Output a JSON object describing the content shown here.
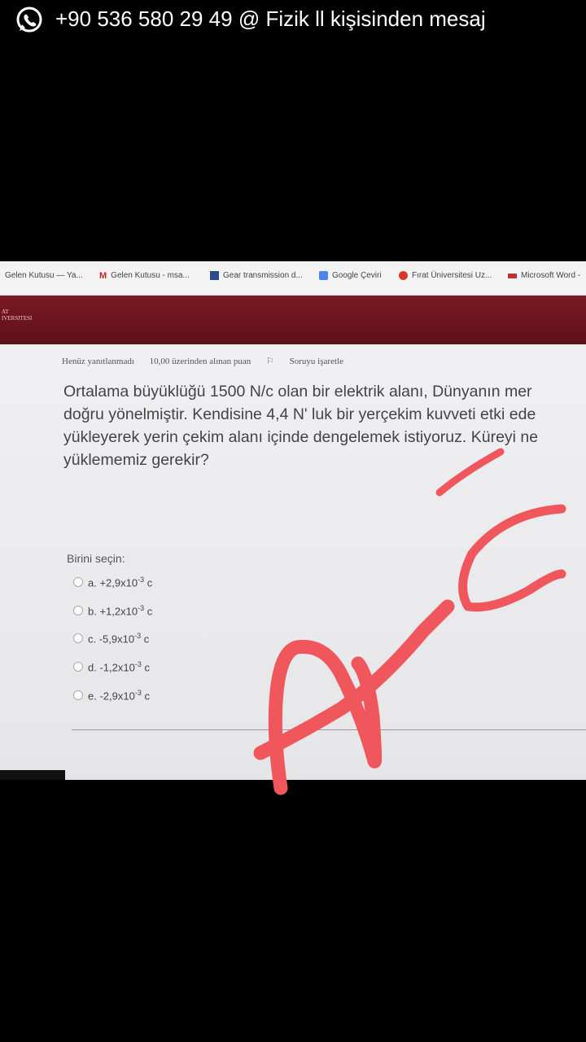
{
  "notification": {
    "icon": "whatsapp-icon",
    "text": "+90 536 580 29 49 @ Fizik ll kişisinden mesaj"
  },
  "bookmarks": [
    {
      "label": "Gelen Kutusu — Ya...",
      "icon": "yahoo-icon"
    },
    {
      "label": "Gelen Kutusu - msa...",
      "icon": "gmail-icon"
    },
    {
      "label": "Gear transmission d...",
      "icon": "page-icon"
    },
    {
      "label": "Google Çeviri",
      "icon": "translate-icon"
    },
    {
      "label": "Fırat Üniversitesi Uz...",
      "icon": "university-icon"
    },
    {
      "label": "Microsoft Word -",
      "icon": "word-icon"
    }
  ],
  "university_logo": {
    "line1": "AT",
    "line2": "IVERSITESI"
  },
  "quiz": {
    "status": "Henüz yanıtlanmadı",
    "points": "10,00 üzerinden alınan puan",
    "flag": "Soruyu işaretle",
    "question_lines": [
      "Ortalama büyüklüğü 1500 N/c olan bir elektrik alanı, Dünyanın mer",
      "doğru yönelmiştir. Kendisine 4,4 N' luk bir yerçekim kuvveti etki ede",
      "yükleyerek yerin çekim alanı içinde dengelemek istiyoruz. Küreyi ne",
      "yüklememiz gerekir?"
    ],
    "choose_label": "Birini seçin:",
    "options": [
      {
        "prefix": "a. +2,9x10",
        "exp": "-3",
        "unit": " c"
      },
      {
        "prefix": "b. +1,2x10",
        "exp": "-3",
        "unit": " c"
      },
      {
        "prefix": "c. -5,9x10",
        "exp": "-3",
        "unit": " c"
      },
      {
        "prefix": "d. -1,2x10",
        "exp": "-3",
        "unit": " c"
      },
      {
        "prefix": "e.  -2,9x10",
        "exp": "-3",
        "unit": " c"
      }
    ]
  },
  "colors": {
    "annotation": "#f0575c",
    "university_bar": "#6e1520"
  }
}
